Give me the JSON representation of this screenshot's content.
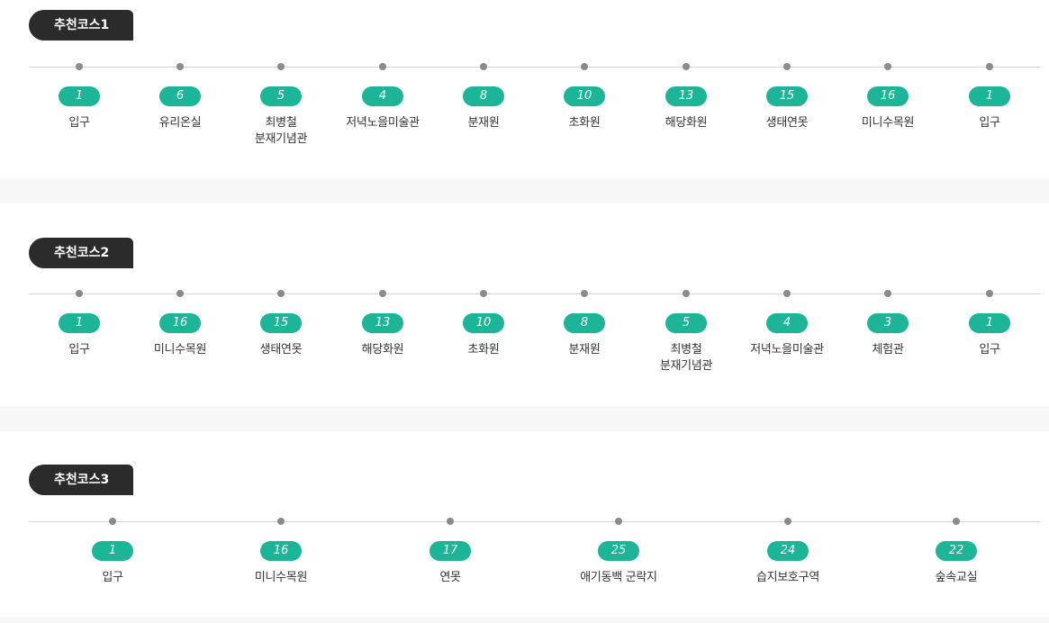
{
  "courses": [
    {
      "title": "추천코스1",
      "stops": [
        {
          "num": "1",
          "name": "입구"
        },
        {
          "num": "6",
          "name": "유리온실"
        },
        {
          "num": "5",
          "name": "최병철\n분재기념관"
        },
        {
          "num": "4",
          "name": "저녁노을미술관"
        },
        {
          "num": "8",
          "name": "분재원"
        },
        {
          "num": "10",
          "name": "초화원"
        },
        {
          "num": "13",
          "name": "해당화원"
        },
        {
          "num": "15",
          "name": "생태연못"
        },
        {
          "num": "16",
          "name": "미니수목원"
        },
        {
          "num": "1",
          "name": "입구"
        }
      ]
    },
    {
      "title": "추천코스2",
      "stops": [
        {
          "num": "1",
          "name": "입구"
        },
        {
          "num": "16",
          "name": "미니수목원"
        },
        {
          "num": "15",
          "name": "생태연못"
        },
        {
          "num": "13",
          "name": "해당화원"
        },
        {
          "num": "10",
          "name": "초화원"
        },
        {
          "num": "8",
          "name": "분재원"
        },
        {
          "num": "5",
          "name": "최병철\n분재기념관"
        },
        {
          "num": "4",
          "name": "저녁노을미술관"
        },
        {
          "num": "3",
          "name": "체험관"
        },
        {
          "num": "1",
          "name": "입구"
        }
      ]
    },
    {
      "title": "추천코스3",
      "stops": [
        {
          "num": "1",
          "name": "입구"
        },
        {
          "num": "16",
          "name": "미니수목원"
        },
        {
          "num": "17",
          "name": "연못"
        },
        {
          "num": "25",
          "name": "애기동백 군락지"
        },
        {
          "num": "24",
          "name": "습지보호구역"
        },
        {
          "num": "22",
          "name": "숲속교실"
        }
      ]
    }
  ],
  "colors": {
    "badge_bg": "#2b2b2b",
    "number_pill": "#1db597",
    "dot": "#8a8a8a",
    "line": "#d6d6d6",
    "divider_band": "#f7f7f7"
  }
}
